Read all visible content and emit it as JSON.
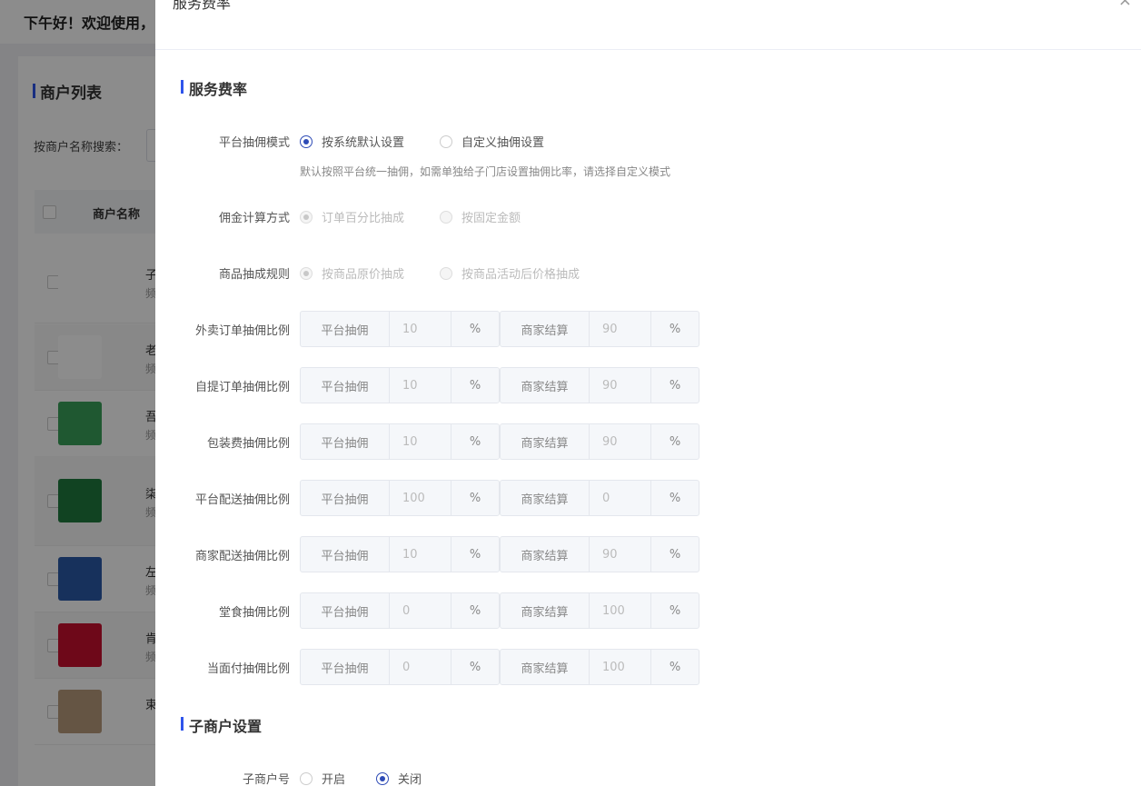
{
  "background": {
    "greeting": "下午好！欢迎使用，",
    "card_title": "商户列表",
    "search_label": "按商户名称搜索：",
    "table_header": "商户名称",
    "rows": [
      {
        "name": "子",
        "sub": "频",
        "logo_color": "#ffffff"
      },
      {
        "name": "老",
        "sub": "频",
        "logo_color": "#ffffff"
      },
      {
        "name": "吾",
        "sub": "频",
        "logo_color": "#3aa05a"
      },
      {
        "name": "柒",
        "sub": "频",
        "logo_color": "#1f7a3e"
      },
      {
        "name": "左",
        "sub": "频",
        "logo_color": "#2b5aa8"
      },
      {
        "name": "肯",
        "sub": "频",
        "logo_color": "#c8102e"
      },
      {
        "name": "束",
        "sub": "",
        "logo_color": "#b89c7c"
      }
    ]
  },
  "drawer": {
    "title": "服务费率",
    "close": "×",
    "section1_title": "服务费率",
    "mode": {
      "label": "平台抽佣模式",
      "options": [
        "按系统默认设置",
        "自定义抽佣设置"
      ],
      "selected": 0,
      "hint": "默认按照平台统一抽佣，如需单独给子门店设置抽佣比率，请选择自定义模式"
    },
    "calc": {
      "label": "佣金计算方式",
      "options": [
        "订单百分比抽成",
        "按固定金额"
      ]
    },
    "rule": {
      "label": "商品抽成规则",
      "options": [
        "按商品原价抽成",
        "按商品活动后价格抽成"
      ]
    },
    "platform_label": "平台抽佣",
    "merchant_label": "商家结算",
    "unit": "%",
    "rows": [
      {
        "label": "外卖订单抽佣比例",
        "platform": "10",
        "merchant": "90"
      },
      {
        "label": "自提订单抽佣比例",
        "platform": "10",
        "merchant": "90"
      },
      {
        "label": "包装费抽佣比例",
        "platform": "10",
        "merchant": "90"
      },
      {
        "label": "平台配送抽佣比例",
        "platform": "100",
        "merchant": "0"
      },
      {
        "label": "商家配送抽佣比例",
        "platform": "10",
        "merchant": "90"
      },
      {
        "label": "堂食抽佣比例",
        "platform": "0",
        "merchant": "100"
      },
      {
        "label": "当面付抽佣比例",
        "platform": "0",
        "merchant": "100"
      }
    ],
    "section2_title": "子商户设置",
    "submerchant": {
      "label": "子商户号",
      "options": [
        "开启",
        "关闭"
      ],
      "selected": 1
    },
    "accent_color": "#2e4bb6"
  }
}
